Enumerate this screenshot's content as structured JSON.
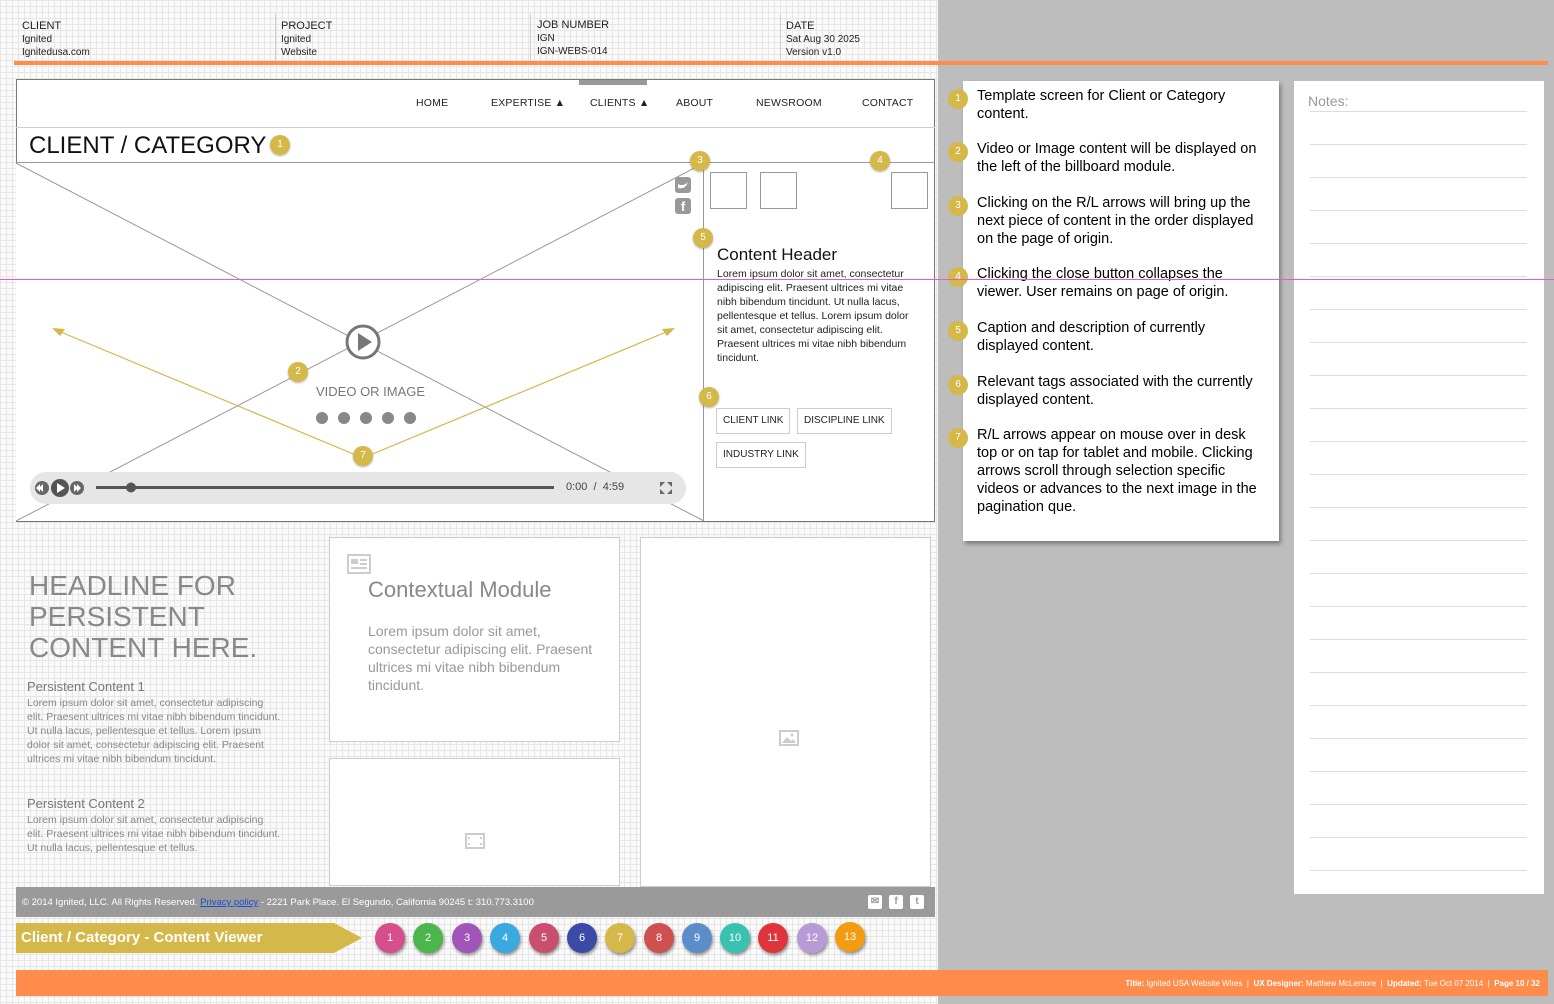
{
  "header": {
    "client_label": "CLIENT",
    "client_line1": "Ignited",
    "client_line2": "Ignitedusa.com",
    "project_label": "PROJECT",
    "project_line1": "Ignited",
    "project_line2": "Website",
    "job_label": "JOB NUMBER",
    "job_line1": "IGN",
    "job_line2": "IGN-WEBS-014",
    "date_label": "DATE",
    "date_line1": "Sat Aug 30 2025",
    "date_line2": "Version v1.0"
  },
  "nav": {
    "home": "HOME",
    "expertise": "EXPERTISE ▲",
    "clients": "CLIENTS ▲",
    "about": "ABOUT",
    "newsroom": "NEWSROOM",
    "contact": "CONTACT"
  },
  "page_title": "CLIENT / CATEGORY",
  "billboard": {
    "video_label": "VIDEO OR IMAGE",
    "time_current": "0:00",
    "time_sep": "/",
    "time_total": "4:59"
  },
  "content": {
    "header": "Content Header",
    "body": "Lorem ipsum dolor sit amet, consectetur adipiscing elit. Praesent ultrices mi vitae nibh bibendum tincidunt. Ut nulla lacus, pellentesque et tellus. Lorem ipsum dolor sit amet, consectetur adipiscing elit. Praesent ultrices mi vitae nibh bibendum tincidunt.",
    "tags": [
      "CLIENT LINK",
      "DISCIPLINE LINK",
      "INDUSTRY LINK"
    ]
  },
  "persistent": {
    "headline": "HEADLINE FOR PERSISTENT CONTENT HERE.",
    "item1_title": "Persistent Content 1",
    "item1_body": "Lorem ipsum dolor sit amet, consectetur adipiscing elit. Praesent ultrices mi vitae nibh bibendum tincidunt. Ut nulla lacus, pellentesque et tellus. Lorem ipsum dolor sit amet, consectetur adipiscing elit. Praesent ultrices mi vitae nibh bibendum tincidunt.",
    "item2_title": "Persistent Content 2",
    "item2_body": "Lorem ipsum dolor sit amet, consectetur adipiscing elit. Praesent ultrices mi vitae nibh bibendum tincidunt. Ut nulla lacus, pellentesque et tellus."
  },
  "contextual": {
    "title": "Contextual Module",
    "body": "Lorem ipsum dolor sit amet, consectetur adipiscing elit. Praesent ultrices mi vitae nibh bibendum tincidunt."
  },
  "footer": {
    "copyright": "© 2014 Ignited, LLC. All Rights Reserved.",
    "privacy": "Privacy policy",
    "address": " -  2221 Park Place. El Segundo, California 90245 t: 310.773.3100"
  },
  "ribbon_label": "Client / Category - Content Viewer",
  "page_circles": [
    {
      "n": "1",
      "color": "#d64f8a"
    },
    {
      "n": "2",
      "color": "#4cb54c"
    },
    {
      "n": "3",
      "color": "#a155b9"
    },
    {
      "n": "4",
      "color": "#3aa9e0"
    },
    {
      "n": "5",
      "color": "#c94f6f"
    },
    {
      "n": "6",
      "color": "#3b4aa6"
    },
    {
      "n": "7",
      "color": "#d5b84a"
    },
    {
      "n": "8",
      "color": "#d04f4f"
    },
    {
      "n": "9",
      "color": "#5b8ec9"
    },
    {
      "n": "10",
      "color": "#37c3b0"
    },
    {
      "n": "11",
      "color": "#e0343c"
    },
    {
      "n": "12",
      "color": "#b79ad6"
    },
    {
      "n": "13",
      "color": "#f39c12"
    }
  ],
  "bottom_bar": {
    "title_label": "Title:",
    "title_value": "Ignited USA Website Wires",
    "designer_label": "UX Designer:",
    "designer_value": "Matthew McLemore",
    "updated_label": "Updated:",
    "updated_value": "Tue Oct 07 2014",
    "page_label": "Page 10 / 32",
    "sep": "|"
  },
  "annotations": [
    {
      "n": "1",
      "text": "Template screen for Client or Category content."
    },
    {
      "n": "2",
      "text": "Video or Image content will be displayed on the left of the billboard module."
    },
    {
      "n": "3",
      "text": "Clicking on the R/L arrows will bring up the next piece of content in the order displayed on the page of origin."
    },
    {
      "n": "4",
      "text": "Clicking the close button collapses the viewer. User remains on page of origin."
    },
    {
      "n": "5",
      "text": "Caption and description of currently displayed content."
    },
    {
      "n": "6",
      "text": "Relevant tags associated with the currently displayed content."
    },
    {
      "n": "7",
      "text": "R/L arrows appear on mouse over in desk top or on tap for tablet and mobile. Clicking arrows scroll through selection specific videos or advances to the next image in the pagination que."
    }
  ],
  "notes_label": "Notes:",
  "markers": [
    "1",
    "2",
    "3",
    "4",
    "5",
    "6",
    "7"
  ],
  "colors": {
    "orange": "#ff8c4b",
    "marker": "#d5b84a",
    "guide": "#e05ae0"
  }
}
